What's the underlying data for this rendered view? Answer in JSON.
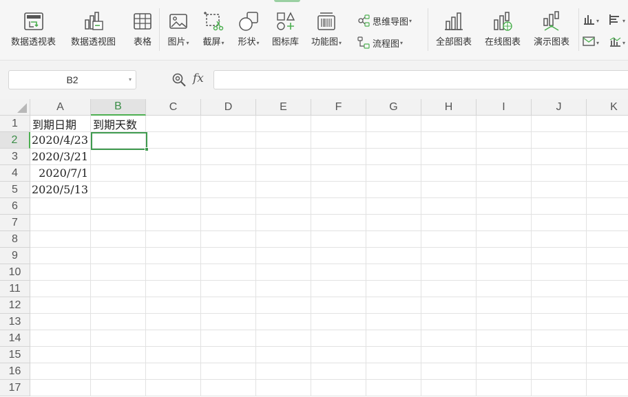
{
  "ribbon": {
    "pivot_table": "数据透视表",
    "pivot_chart": "数据透视图",
    "table": "表格",
    "picture": "图片",
    "screenshot": "截屏",
    "shape": "形状",
    "icon_library": "图标库",
    "function_chart": "功能图",
    "mind_map": "思维导图",
    "flowchart": "流程图",
    "all_charts": "全部图表",
    "online_charts": "在线图表",
    "demo_charts": "演示图表"
  },
  "formula_bar": {
    "name_box": "B2",
    "fx_label": "fx",
    "formula": ""
  },
  "sheet": {
    "columns": [
      "A",
      "B",
      "C",
      "D",
      "E",
      "F",
      "G",
      "H",
      "I",
      "J",
      "K"
    ],
    "rows": [
      "1",
      "2",
      "3",
      "4",
      "5",
      "6",
      "7",
      "8",
      "9",
      "10",
      "11",
      "12",
      "13",
      "14",
      "15",
      "16",
      "17"
    ],
    "cells": {
      "A1": "到期日期",
      "B1": "到期天数",
      "A2": "2020/4/23",
      "A3": "2020/3/21",
      "A4": "2020/7/1",
      "A5": "2020/5/13"
    },
    "selected_cell": "B2",
    "accent_color": "#3f9b4f"
  }
}
